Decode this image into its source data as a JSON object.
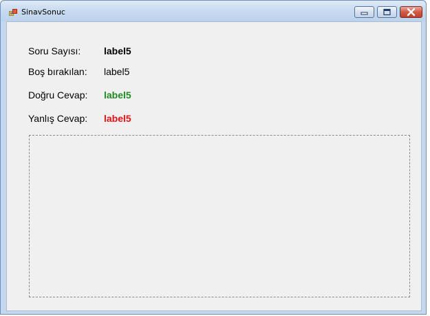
{
  "window": {
    "title": "SinavSonuc",
    "icon": "windows-form-icon"
  },
  "controls": {
    "minimize": "minimize-icon",
    "maximize": "maximize-icon",
    "close": "close-icon"
  },
  "results": [
    {
      "label": "Soru Sayısı:",
      "value": "label5",
      "style": "bold",
      "color": "#000000"
    },
    {
      "label": "Boş bırakılan:",
      "value": "label5",
      "style": "normal",
      "color": "#000000"
    },
    {
      "label": "Doğru Cevap:",
      "value": "label5",
      "style": "bold",
      "color": "#1e8b22"
    },
    {
      "label": "Yanlış Cevap:",
      "value": "label5",
      "style": "bold",
      "color": "#e81111"
    }
  ]
}
